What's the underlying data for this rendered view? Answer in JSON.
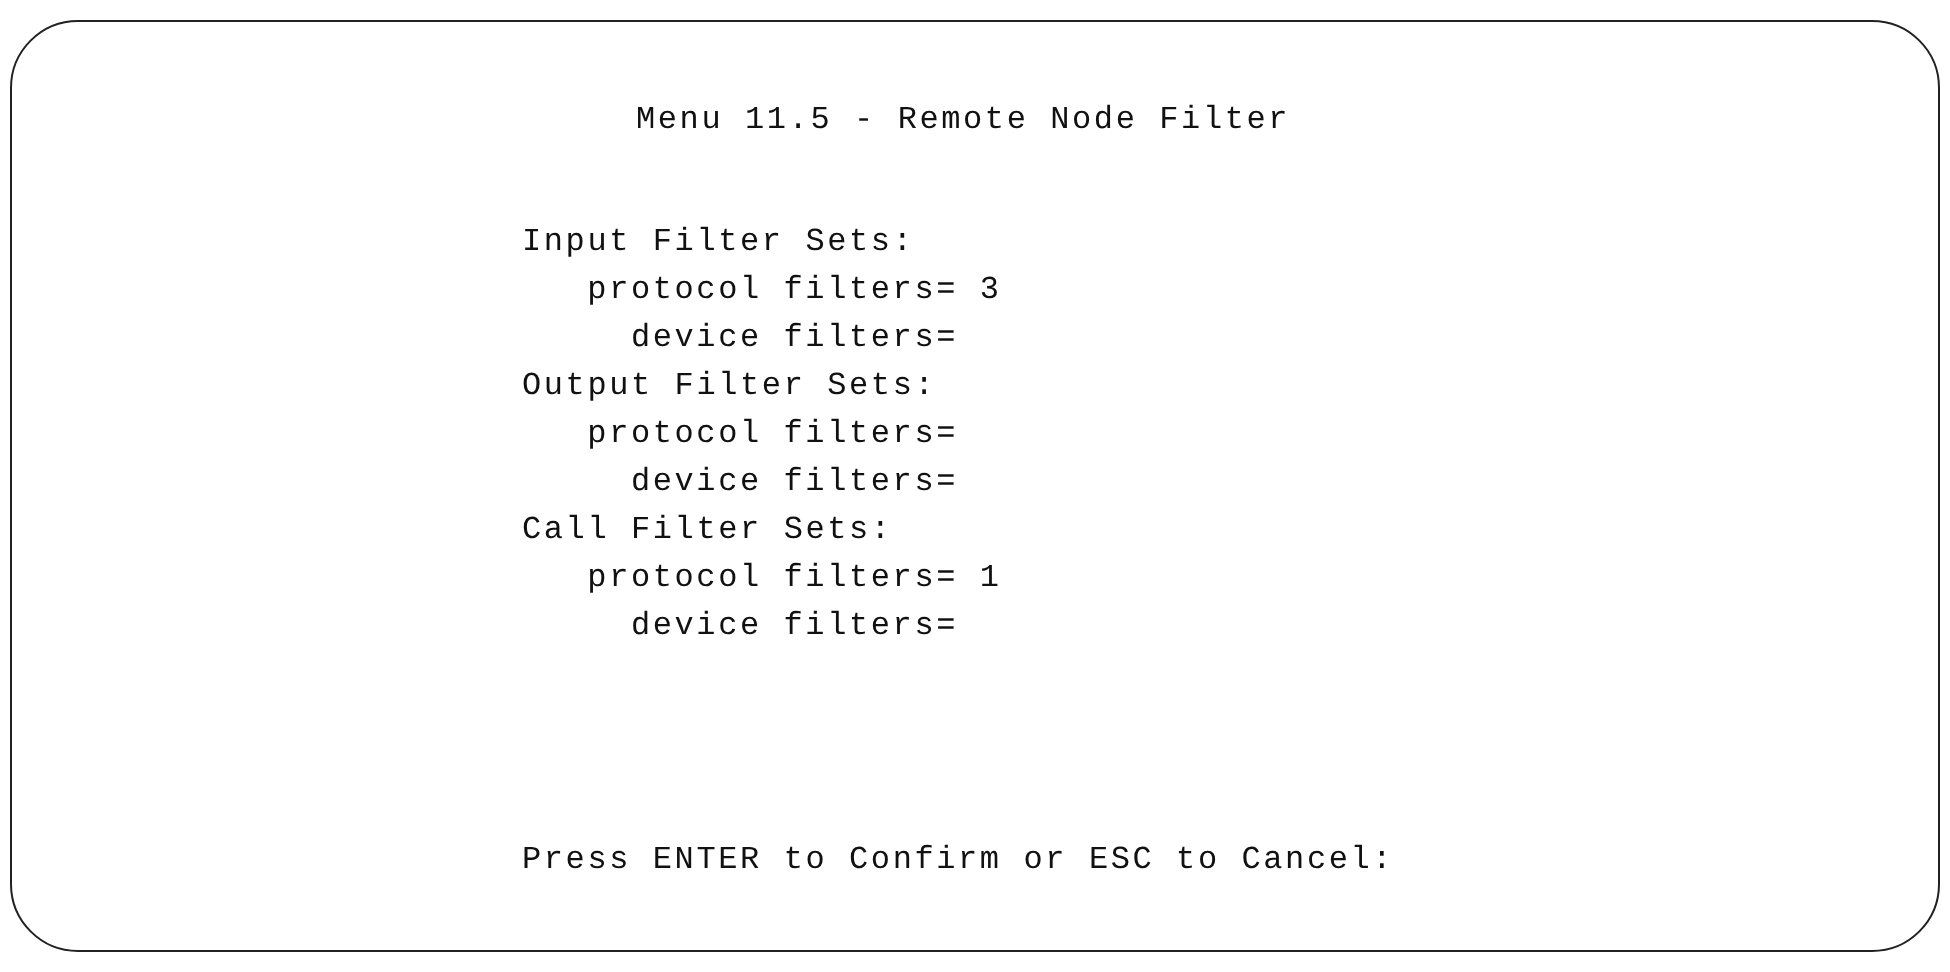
{
  "title": "Menu 11.5 - Remote Node Filter",
  "sections": [
    {
      "heading": "Input Filter Sets:",
      "fields": [
        {
          "label": "protocol filters=",
          "value": "3"
        },
        {
          "label": "device filters="
        }
      ]
    },
    {
      "heading": "Output Filter Sets:",
      "fields": [
        {
          "label": "protocol filters="
        },
        {
          "label": "device filters="
        }
      ]
    },
    {
      "heading": "Call Filter Sets:",
      "fields": [
        {
          "label": "protocol filters=",
          "value": "1"
        },
        {
          "label": "device filters="
        }
      ]
    }
  ],
  "prompt": "Press ENTER to Confirm or ESC to Cancel:"
}
